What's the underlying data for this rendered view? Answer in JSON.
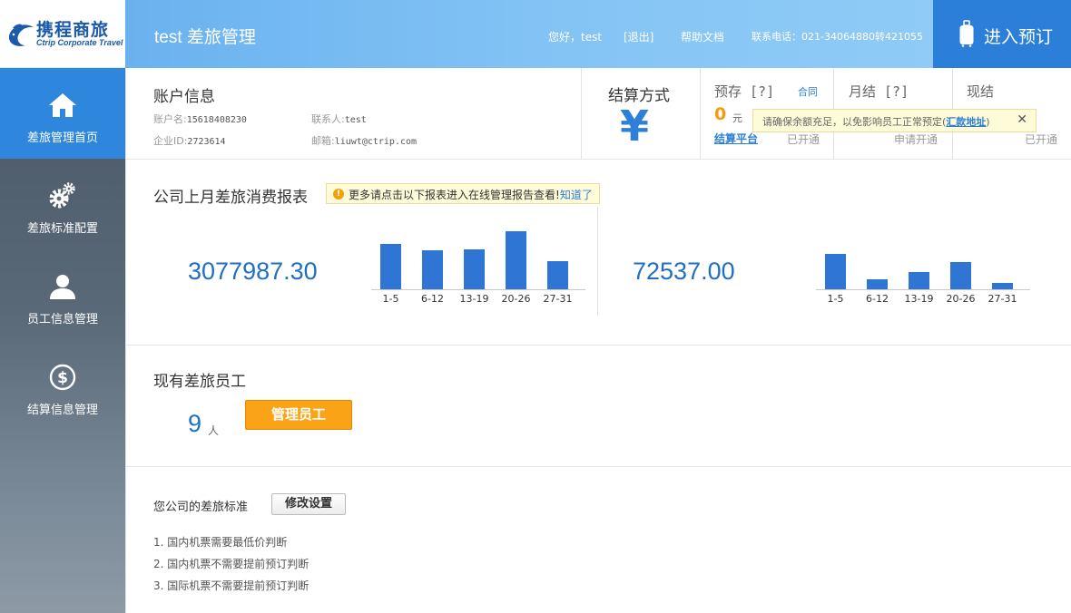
{
  "logo": {
    "cn": "携程商旅",
    "en": "Ctrip Corporate Travel"
  },
  "header": {
    "title": "test 差旅管理",
    "greeting": "您好，test",
    "logout": "[退出]",
    "help": "帮助文档",
    "phone": "联系电话：021-34064880转421055",
    "book_label": "进入预订"
  },
  "sidebar": {
    "items": [
      {
        "label": "差旅管理首页",
        "icon": "home-icon",
        "active": true
      },
      {
        "label": "差旅标准配置",
        "icon": "gears-icon"
      },
      {
        "label": "员工信息管理",
        "icon": "user-icon"
      },
      {
        "label": "结算信息管理",
        "icon": "dollar-icon"
      }
    ]
  },
  "account": {
    "title": "账户信息",
    "username_label": "账户名:",
    "username": "15618408230",
    "contact_label": "联系人:",
    "contact": "test",
    "company_label": "企业ID:",
    "company_id": "2723614",
    "email_label": "邮箱:",
    "email": "liuwt@ctrip.com"
  },
  "settlement": {
    "title": "结算方式",
    "icon": "yen-icon",
    "prepaid_label": "预存 [?]",
    "contract_link": "合同",
    "prepaid_amount": "0",
    "prepaid_unit": "元",
    "settle_platform_link": "结算平台",
    "prepaid_status": "已开通",
    "monthly_label": "月结 [?]",
    "monthly_status": "申请开通",
    "cash_label": "现结",
    "cash_status": "已开通",
    "warning_prefix": "请确保余额充足，以免影响员工正常预定(",
    "warning_link": "汇款地址",
    "warning_suffix": ")",
    "warning_close": "✕"
  },
  "report": {
    "title": "公司上月差旅消费报表",
    "tip_icon": "!",
    "tip_text": "更多请点击以下报表进入在线管理报告查看!",
    "tip_link": "知道了",
    "total_1": "3077987.30",
    "total_2": "72537.00"
  },
  "chart_data": [
    {
      "type": "bar",
      "categories": [
        "1-5",
        "6-12",
        "13-19",
        "20-26",
        "27-31"
      ],
      "values": [
        50,
        43,
        44,
        64,
        31
      ],
      "title": "",
      "xlabel": "",
      "ylabel": "",
      "grid": false
    },
    {
      "type": "bar",
      "categories": [
        "1-5",
        "6-12",
        "13-19",
        "20-26",
        "27-31"
      ],
      "values": [
        39,
        11,
        19,
        30,
        7
      ],
      "title": "",
      "xlabel": "",
      "ylabel": "",
      "grid": false
    }
  ],
  "employees": {
    "title": "现有差旅员工",
    "count": "9",
    "unit": "人",
    "manage_button": "管理员工"
  },
  "standards": {
    "title": "您公司的差旅标准",
    "edit_button": "修改设置",
    "items": [
      "1. 国内机票需要最低价判断",
      "2. 国内机票不需要提前预订判断",
      "3. 国际机票不需要提前预订判断"
    ]
  },
  "colors": {
    "accent": "#2c80d8",
    "active_nav": "#2f86dd",
    "warning": "#f39c12",
    "button_orange": "#fba317",
    "bar": "#2f76d4"
  }
}
